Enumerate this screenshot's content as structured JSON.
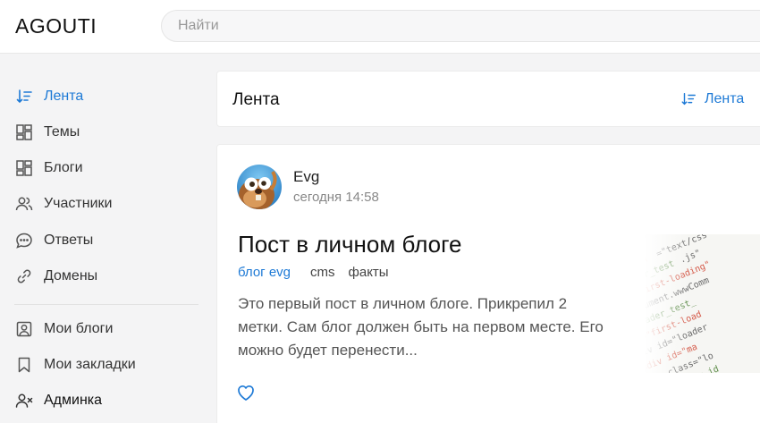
{
  "header": {
    "logo": "AGOUTI",
    "search_placeholder": "Найти"
  },
  "sidebar": {
    "items": [
      {
        "label": "Лента",
        "icon": "sort-icon",
        "active": true
      },
      {
        "label": "Темы",
        "icon": "grid-icon"
      },
      {
        "label": "Блоги",
        "icon": "grid-icon"
      },
      {
        "label": "Участники",
        "icon": "users-icon"
      },
      {
        "label": "Ответы",
        "icon": "chat-icon"
      },
      {
        "label": "Домены",
        "icon": "link-icon"
      }
    ],
    "user_items": [
      {
        "label": "Мои блоги",
        "icon": "user-square-icon"
      },
      {
        "label": "Мои закладки",
        "icon": "bookmark-icon"
      },
      {
        "label": "Админка",
        "icon": "user-x-icon"
      }
    ]
  },
  "feed": {
    "title": "Лента",
    "sort_label": "Лента"
  },
  "post": {
    "author": "Evg",
    "date": "сегодня 14:58",
    "title": "Пост в личном блоге",
    "blog_tag": "блог evg",
    "tags": [
      "cms",
      "факты"
    ],
    "excerpt": "Это первый пост в личном блоге. Прикрепил 2 метки. Сам блог должен быть на первом месте. Его можно будет перенести..."
  },
  "colors": {
    "accent": "#1e7ad6",
    "background": "#f4f4f5"
  }
}
